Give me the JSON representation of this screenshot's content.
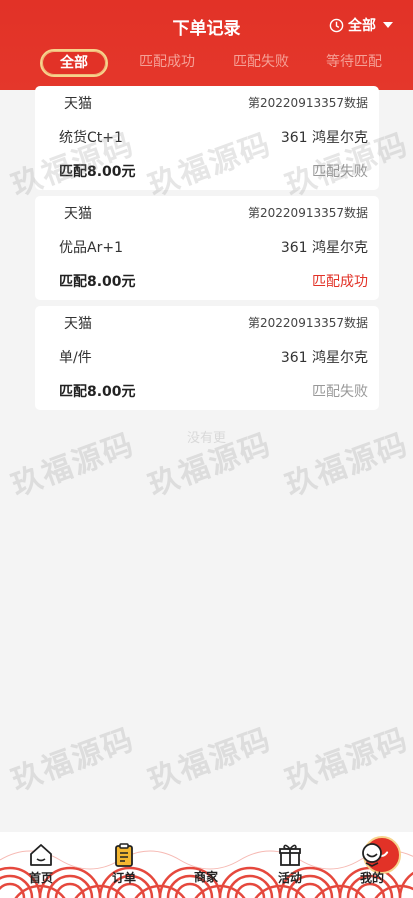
{
  "header": {
    "title": "下单记录",
    "filter_label": "全部"
  },
  "tabs": [
    {
      "label": "全部"
    },
    {
      "label": "匹配成功"
    },
    {
      "label": "匹配失败"
    },
    {
      "label": "等待匹配"
    }
  ],
  "orders": [
    {
      "platform": "天猫",
      "order_no": "第20220913357数据",
      "product": "统货Ct+1",
      "seller": "361 鸿星尔克",
      "amount": "匹配8.00元",
      "status": "匹配失败"
    },
    {
      "platform": "天猫",
      "order_no": "第20220913357数据",
      "product": "优品Ar+1",
      "seller": "361 鸿星尔克",
      "amount": "匹配8.00元",
      "status": "匹配成功"
    },
    {
      "platform": "天猫",
      "order_no": "第20220913357数据",
      "product": "单/件",
      "seller": "361 鸿星尔克",
      "amount": "匹配8.00元",
      "status": "匹配失败"
    }
  ],
  "list_footer": "没有更",
  "watermark_text": "玖福源码",
  "nav": [
    {
      "label": "首页",
      "icon": "home-icon"
    },
    {
      "label": "订单",
      "icon": "clipboard-icon"
    },
    {
      "label": "商家",
      "icon": "shopping-bag-icon"
    },
    {
      "label": "活动",
      "icon": "gift-icon"
    },
    {
      "label": "我的",
      "icon": "user-face-icon"
    }
  ],
  "colors": {
    "brand_red": "#e23227",
    "gold_border": "#f6d38c",
    "success": "#e23227",
    "fail": "#999999"
  }
}
